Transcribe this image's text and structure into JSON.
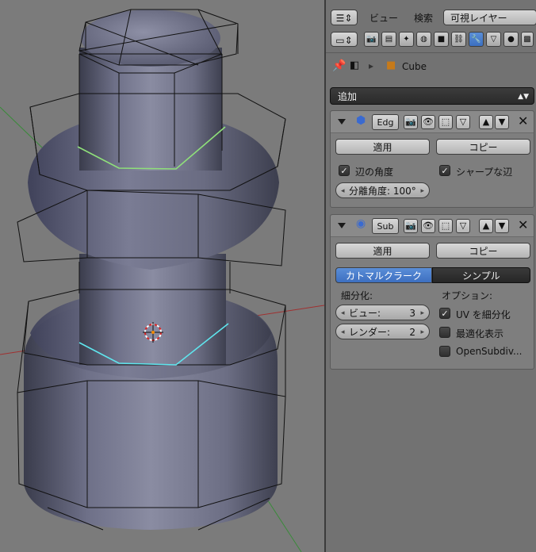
{
  "header": {
    "menu_view": "ビュー",
    "menu_search": "検索",
    "visible_layer": "可視レイヤー"
  },
  "breadcrumb": {
    "object_name": "Cube"
  },
  "add_modifier": {
    "label": "追加"
  },
  "modifiers": [
    {
      "name": "Edg",
      "apply_label": "適用",
      "copy_label": "コピー",
      "edge_angle": {
        "label": "辺の角度",
        "checked": true
      },
      "sharp_edges": {
        "label": "シャープな辺",
        "checked": true
      },
      "split_angle": "分離角度: 100°"
    },
    {
      "name": "Sub",
      "apply_label": "適用",
      "copy_label": "コピー",
      "type_catmull": "カトマルクラーク",
      "type_simple": "シンプル",
      "subdivisions_label": "細分化:",
      "view_label": "ビュー:",
      "view_value": "3",
      "render_label": "レンダー:",
      "render_value": "2",
      "options_label": "オプション:",
      "uv_subdiv": {
        "label": "UV を細分化",
        "checked": true
      },
      "optimal_display": {
        "label": "最適化表示",
        "checked": false
      },
      "opensubdiv": {
        "label": "OpenSubdiv...",
        "checked": false
      }
    }
  ],
  "colors": {
    "viewport_bg": "#7b7b7b",
    "panel_bg": "#727272",
    "active_blue": "#4a7fcf",
    "mesh_color": "#5e6076"
  }
}
